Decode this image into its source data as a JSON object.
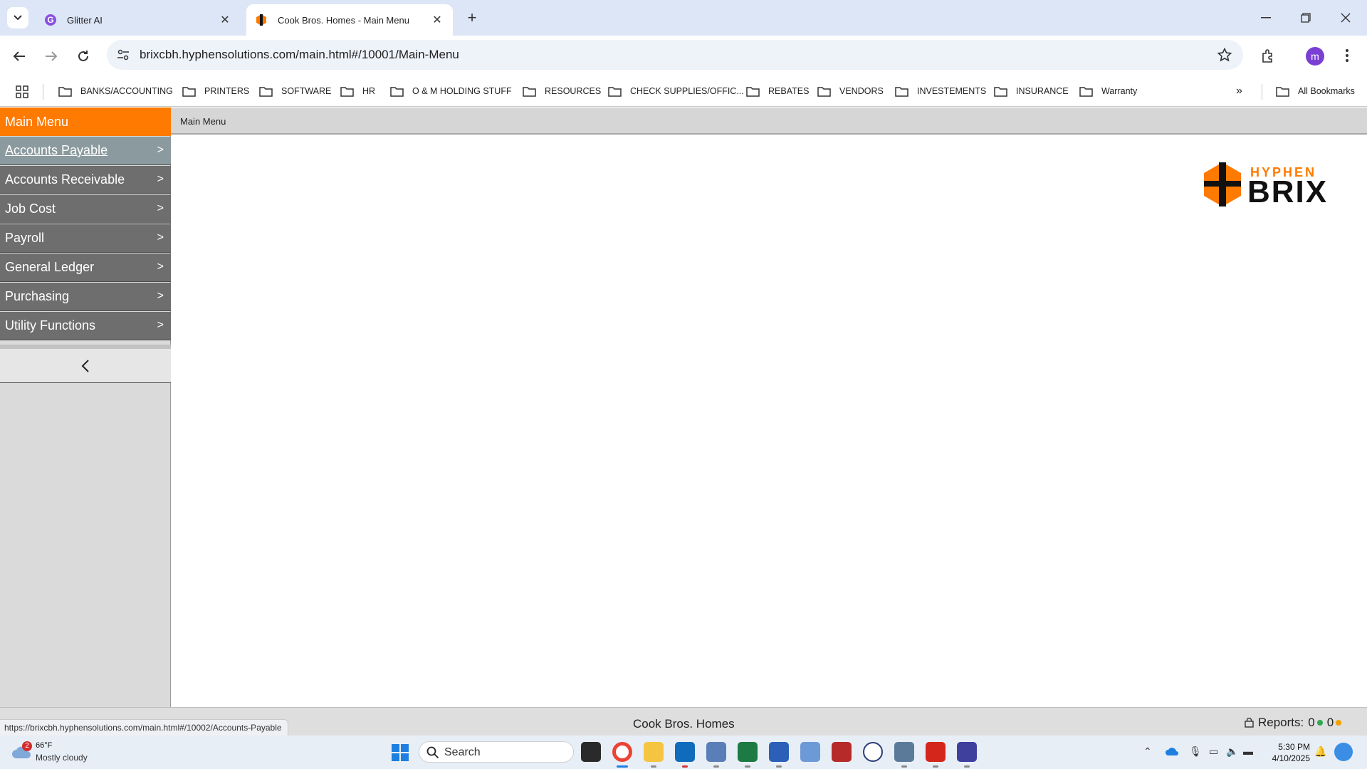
{
  "browser": {
    "tabs": [
      {
        "title": "Glitter AI",
        "favicon": "glitter-g-icon",
        "active": false
      },
      {
        "title": "Cook Bros. Homes - Main Menu",
        "favicon": "hyphen-brix-icon",
        "active": true
      }
    ],
    "url": "brixcbh.hyphensolutions.com/main.html#/10001/Main-Menu",
    "profile_initial": "m",
    "bookmarks": [
      "BANKS/ACCOUNTING",
      "PRINTERS",
      "SOFTWARE",
      "HR",
      "O & M HOLDING STUFF",
      "RESOURCES",
      "CHECK SUPPLIES/OFFIC...",
      "REBATES",
      "VENDORS",
      "INVESTEMENTS",
      "INSURANCE",
      "Warranty"
    ],
    "more_bookmarks": "»",
    "all_bookmarks": "All Bookmarks"
  },
  "app": {
    "menu_title": "Main Menu",
    "breadcrumb": "Main Menu",
    "menu_items": [
      {
        "label": "Accounts Payable",
        "arrow": ">",
        "highlighted": true
      },
      {
        "label": "Accounts Receivable",
        "arrow": ">",
        "highlighted": false
      },
      {
        "label": "Job Cost",
        "arrow": ">",
        "highlighted": false
      },
      {
        "label": "Payroll",
        "arrow": ">",
        "highlighted": false
      },
      {
        "label": "General Ledger",
        "arrow": ">",
        "highlighted": false
      },
      {
        "label": "Purchasing",
        "arrow": ">",
        "highlighted": false
      },
      {
        "label": "Utility Functions",
        "arrow": ">",
        "highlighted": false
      }
    ],
    "logo": {
      "top": "HYPHEN",
      "bottom": "BRIX"
    },
    "status": {
      "hover_url": "https://brixcbh.hyphensolutions.com/main.html#/10002/Accounts-Payable",
      "company": "Cook Bros. Homes",
      "reports_label": "Reports:",
      "reports_green": "0",
      "reports_orange": "0"
    },
    "colors": {
      "accent": "#ff7a00",
      "menu_bg": "#6e6e6e",
      "menu_highlight": "#8b9a9e"
    }
  },
  "taskbar": {
    "weather": {
      "temp": "66°F",
      "condition": "Mostly cloudy",
      "badge": "2"
    },
    "search_label": "Search",
    "time": "5:30 PM",
    "date": "4/10/2025"
  }
}
